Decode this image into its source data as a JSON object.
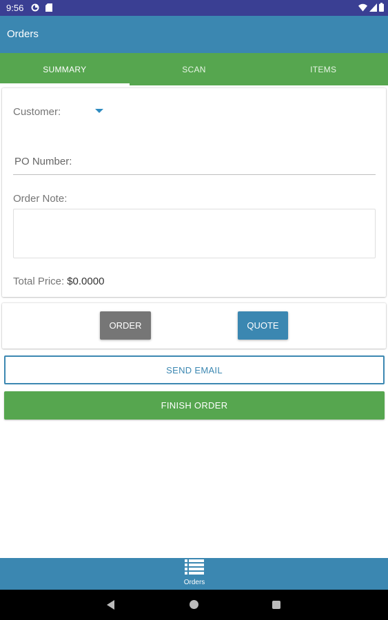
{
  "status_bar": {
    "time": "9:56",
    "icons": [
      "app-notification-icon",
      "sd-card-icon",
      "wifi-icon",
      "signal-icon",
      "battery-icon"
    ]
  },
  "app_bar": {
    "title": "Orders"
  },
  "tabs": [
    {
      "label": "SUMMARY",
      "active": true
    },
    {
      "label": "SCAN",
      "active": false
    },
    {
      "label": "ITEMS",
      "active": false
    }
  ],
  "summary": {
    "customer_label": "Customer:",
    "po_placeholder": "PO Number:",
    "po_value": "",
    "note_label": "Order Note:",
    "note_value": "",
    "total_label": "Total Price:",
    "total_value": "$0.0000"
  },
  "actions": {
    "order_label": "ORDER",
    "quote_label": "QUOTE",
    "send_email_label": "SEND EMAIL",
    "finish_order_label": "FINISH ORDER"
  },
  "bottom_nav": {
    "orders_label": "Orders",
    "icon": "list-icon"
  },
  "colors": {
    "status_bar": "#3a3f93",
    "primary": "#3b87b1",
    "accent_green": "#56a64f",
    "order_button": "#767676"
  }
}
